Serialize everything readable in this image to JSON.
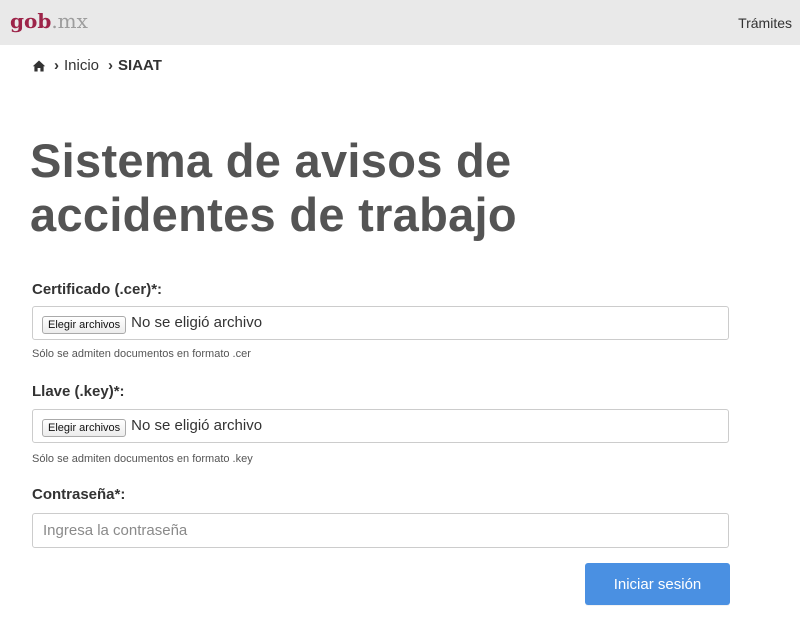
{
  "header": {
    "logo": {
      "gob": "gob",
      "mx": ".mx"
    },
    "nav_link": "Trámites"
  },
  "breadcrumb": {
    "home_icon": "home-icon",
    "separator": "›",
    "items": [
      {
        "label": "Inicio"
      },
      {
        "label": "SIAAT"
      }
    ]
  },
  "page": {
    "title": "Sistema de avisos de accidentes de trabajo"
  },
  "form": {
    "certificate": {
      "label": "Certificado (.cer)*:",
      "button_label": "Elegir archivos",
      "status": "No se eligió archivo",
      "help": "Sólo se admiten documentos en formato .cer"
    },
    "key": {
      "label": "Llave (.key)*:",
      "button_label": "Elegir archivos",
      "status": "No se eligió archivo",
      "help": "Sólo se admiten documentos en formato .key"
    },
    "password": {
      "label": "Contraseña*:",
      "placeholder": "Ingresa la contraseña",
      "value": ""
    },
    "submit_label": "Iniciar sesión"
  },
  "colors": {
    "brand": "#9d2449",
    "logo_gray": "#9d9d9d",
    "header_bg": "#e9e9e9",
    "title": "#545454",
    "button": "#4a90e2"
  }
}
